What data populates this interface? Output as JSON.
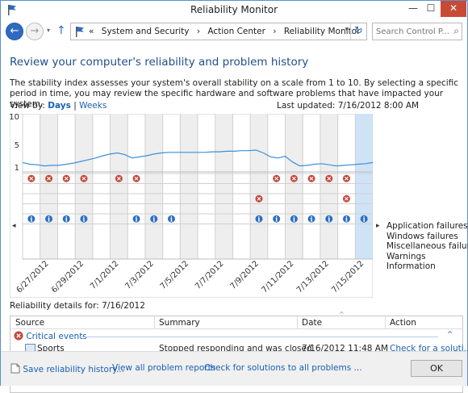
{
  "window": {
    "title": "Reliability Monitor",
    "controls": {
      "minimize": "—",
      "maximize": "☐",
      "close": "✕"
    }
  },
  "address_bar": {
    "breadcrumbs": [
      "«",
      "System and Security",
      "›",
      "Action Center",
      "›",
      "Reliability Monitor"
    ],
    "search_placeholder": "Search Control P..."
  },
  "main": {
    "heading": "Review your computer's reliability and problem history",
    "description": "The stability index assesses your system's overall stability on a scale from 1 to 10. By selecting a specific period in time, you may review the specific hardware and software problems that have impacted your system.",
    "view_by_label": "View by:",
    "view_days": "Days",
    "view_separator": "|",
    "view_weeks": "Weeks",
    "last_updated": "Last updated: 7/16/2012 8:00 AM",
    "chart_row_labels": [
      "Application failures",
      "Windows failures",
      "Miscellaneous failures",
      "Warnings",
      "Information"
    ]
  },
  "chart_data": {
    "type": "line",
    "y_ticks": [
      "10",
      "5",
      "1"
    ],
    "ylim": [
      1,
      10
    ],
    "x_tick_labels": [
      "6/27/2012",
      "6/29/2012",
      "7/1/2012",
      "7/3/2012",
      "7/5/2012",
      "7/7/2012",
      "7/9/2012",
      "7/11/2012",
      "7/13/2012",
      "7/15/2012"
    ],
    "selected_date": "7/16/2012",
    "stability_index": [
      1.8,
      1.5,
      1.4,
      1.2,
      1.3,
      1.3,
      1.5,
      1.7,
      2.0,
      2.3,
      2.6,
      3.0,
      3.3,
      3.5,
      3.2,
      2.6,
      2.8,
      3.0,
      3.3,
      3.5,
      3.6,
      3.6,
      3.6,
      3.6,
      3.6,
      3.6,
      3.7,
      3.7,
      3.8,
      3.8,
      3.9,
      3.9,
      4.0,
      3.5,
      2.8,
      2.6,
      2.9,
      1.9,
      1.2,
      1.3,
      1.5,
      1.6,
      1.4,
      1.2,
      1.3,
      1.4,
      1.5,
      1.6,
      1.8
    ],
    "event_rows": {
      "application_failures": [
        1,
        1,
        1,
        1,
        0,
        1,
        1,
        0,
        0,
        0,
        0,
        0,
        0,
        0,
        1,
        1,
        1,
        1,
        1,
        0
      ],
      "windows_failures": [
        0,
        0,
        0,
        0,
        0,
        0,
        0,
        0,
        0,
        0,
        0,
        0,
        0,
        0,
        0,
        0,
        0,
        0,
        0,
        0
      ],
      "miscellaneous_failures": [
        0,
        0,
        0,
        0,
        0,
        0,
        0,
        0,
        0,
        0,
        0,
        0,
        0,
        1,
        0,
        0,
        0,
        0,
        1,
        0
      ],
      "warnings": [
        0,
        0,
        0,
        0,
        0,
        0,
        0,
        0,
        0,
        0,
        0,
        0,
        0,
        0,
        0,
        0,
        0,
        0,
        0,
        0
      ],
      "information": [
        1,
        1,
        1,
        1,
        0,
        0,
        1,
        1,
        1,
        0,
        0,
        0,
        0,
        1,
        1,
        1,
        1,
        1,
        1,
        1
      ]
    },
    "colors": {
      "line": "#3c8fd9",
      "selected_column": "#cfe3f7",
      "failure_icon": "#c4473a",
      "info_icon": "#2c6fc5",
      "weekend_column": "#eeeeee"
    }
  },
  "details": {
    "label": "Reliability details for: 7/16/2012",
    "columns": [
      "Source",
      "Summary",
      "Date",
      "Action"
    ],
    "group_title": "Critical events",
    "rows": [
      {
        "source": "Sports",
        "summary": "Stopped responding and was closed",
        "date": "7/16/2012 11:48 AM",
        "action": "Check for a soluti..."
      }
    ]
  },
  "footer": {
    "save_history": "Save reliability history...",
    "view_reports": "View all problem reports",
    "check_solutions": "Check for solutions to all problems ...",
    "ok": "OK"
  }
}
